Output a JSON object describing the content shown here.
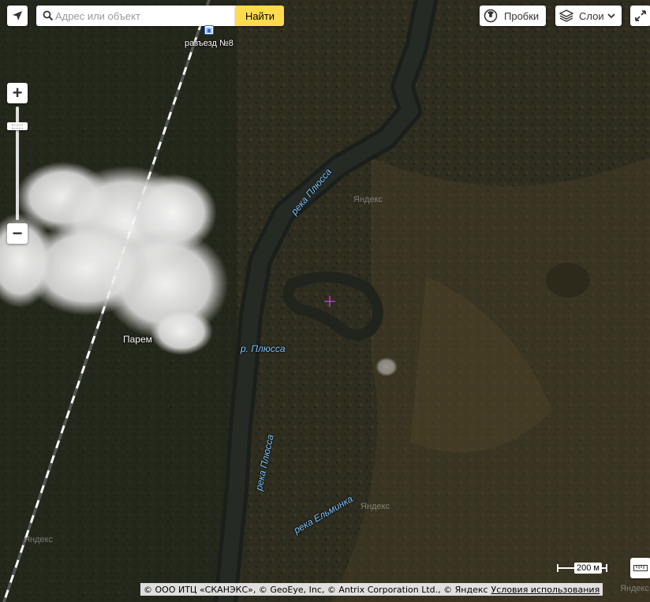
{
  "search": {
    "placeholder": "Адрес или объект",
    "button_label": "Найти"
  },
  "toolbar": {
    "traffic_label": "Пробки",
    "layers_label": "Слои"
  },
  "icons": {
    "locate": "navigation-arrow-icon",
    "search": "search-icon",
    "traffic": "traffic-light-icon",
    "layers": "layers-icon",
    "dropdown": "chevron-down-icon",
    "fullscreen": "expand-icon",
    "zoom_in": "plus-icon",
    "zoom_out": "minus-icon",
    "ruler": "ruler-icon",
    "station": "railway-station-icon"
  },
  "zoom": {
    "in_label": "+",
    "out_label": "−",
    "level_fraction": 0.85
  },
  "map": {
    "station_label": "разъезд №8",
    "place_label": "Парем",
    "rivers": [
      "река Плюсса",
      "р. Плюсса",
      "река Плюсса",
      "река Ельминка"
    ],
    "watermarks": [
      "Яндекс",
      "Яндекс",
      "Яндекс",
      "Яндекс"
    ]
  },
  "scale": {
    "label": "200 м"
  },
  "copyright": {
    "text": "© ООО ИТЦ «СКАНЭКС», © GeoEye, Inc, © Antrix Corporation Ltd., © Яндекс",
    "terms_link": "Условия использования"
  },
  "colors": {
    "find_button": "#ffdb4d",
    "river_label": "#7fc6ff",
    "crosshair": "#d040d0"
  }
}
